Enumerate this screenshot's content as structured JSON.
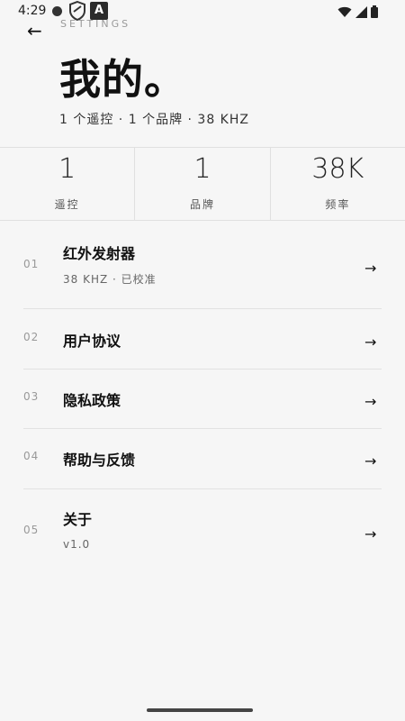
{
  "status_bar": {
    "time": "4:29",
    "app_badge": "A"
  },
  "header": {
    "back_glyph": "←",
    "eyebrow": "SETTINGS",
    "title": "我的。",
    "subtitle": "1 个遥控 · 1 个品牌 · 38 KHZ"
  },
  "stats": [
    {
      "value": "1",
      "label": "遥控"
    },
    {
      "value": "1",
      "label": "品牌"
    },
    {
      "value": "38K",
      "label": "频率"
    }
  ],
  "menu": [
    {
      "index": "01",
      "title": "红外发射器",
      "subtitle": "38 KHZ · 已校准",
      "arrow": "→"
    },
    {
      "index": "02",
      "title": "用户协议",
      "subtitle": "",
      "arrow": "→"
    },
    {
      "index": "03",
      "title": "隐私政策",
      "subtitle": "",
      "arrow": "→"
    },
    {
      "index": "04",
      "title": "帮助与反馈",
      "subtitle": "",
      "arrow": "→"
    },
    {
      "index": "05",
      "title": "关于",
      "subtitle": "v1.0",
      "arrow": "→"
    }
  ],
  "icons": {
    "status": [
      "notification-dot-icon",
      "shield-icon",
      "app-a-icon",
      "wifi-icon",
      "signal-icon",
      "battery-icon"
    ],
    "back": "back-arrow-icon"
  }
}
